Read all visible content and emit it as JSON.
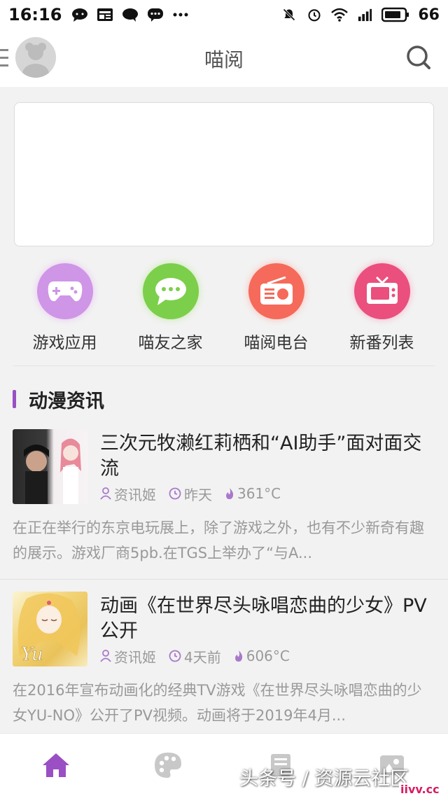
{
  "status_bar": {
    "time": "16:16",
    "battery": "66",
    "network": "4G"
  },
  "app_bar": {
    "title": "喵阅"
  },
  "quick_nav": [
    {
      "label": "游戏应用",
      "icon": "gamepad-icon",
      "color": "#c98fe0"
    },
    {
      "label": "喵友之家",
      "icon": "chat-icon",
      "color": "#7ccf4a"
    },
    {
      "label": "喵阅电台",
      "icon": "radio-icon",
      "color": "#f56a5a"
    },
    {
      "label": "新番列表",
      "icon": "tv-icon",
      "color": "#ea4f7e"
    }
  ],
  "section": {
    "title": "动漫资讯"
  },
  "articles": [
    {
      "title": "三次元牧濑红莉栖和“AI助手”面对面交流",
      "author": "资讯姬",
      "time": "昨天",
      "heat": "361°C",
      "summary": "在正在举行的东京电玩展上，除了游戏之外，也有不少新奇有趣的展示。游戏厂商5pb.在TGS上举办了“与A..."
    },
    {
      "title": "动画《在世界尽头咏唱恋曲的少女》PV公开",
      "author": "资讯姬",
      "time": "4天前",
      "heat": "606°C",
      "summary": "在2016年宣布动画化的经典TV游戏《在世界尽头咏唱恋曲的少女YU-NO》公开了PV视频。动画将于2019年4月..."
    }
  ],
  "bottom_nav": [
    {
      "icon": "home-icon",
      "active": true
    },
    {
      "icon": "palette-icon",
      "active": false
    },
    {
      "icon": "book-icon",
      "active": false
    },
    {
      "icon": "image-icon",
      "active": false
    }
  ],
  "colors": {
    "accent": "#9b4fc4",
    "meta_icon": "#a879c9"
  },
  "watermark": {
    "text": "头条号 / 资源云社区",
    "url": "iivv.cc"
  }
}
